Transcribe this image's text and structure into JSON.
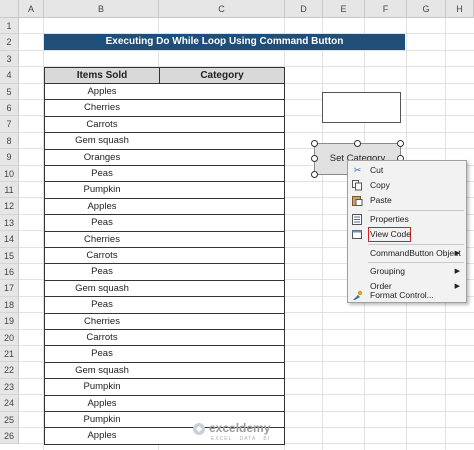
{
  "columns": [
    "A",
    "B",
    "C",
    "D",
    "E",
    "F",
    "G",
    "H"
  ],
  "rows": [
    "1",
    "2",
    "3",
    "4",
    "5",
    "6",
    "7",
    "8",
    "9",
    "10",
    "11",
    "12",
    "13",
    "14",
    "15",
    "16",
    "17",
    "18",
    "19",
    "20",
    "21",
    "22",
    "23",
    "24",
    "25",
    "26"
  ],
  "banner": {
    "title": "Executing Do While Loop Using Command Button"
  },
  "table": {
    "headers": [
      "Items Sold",
      "Category"
    ],
    "items": [
      "Apples",
      "Cherries",
      "Carrots",
      "Gem squash",
      "Oranges",
      "Peas",
      "Pumpkin",
      "Apples",
      "Peas",
      "Cherries",
      "Carrots",
      "Peas",
      "Gem squash",
      "Peas",
      "Cherries",
      "Carrots",
      "Peas",
      "Gem squash",
      "Pumpkin",
      "Apples",
      "Pumpkin",
      "Apples"
    ]
  },
  "command_button": {
    "label": "Set Category"
  },
  "context_menu": {
    "items": [
      {
        "label": "Cut",
        "icon": "scissors-icon"
      },
      {
        "label": "Copy",
        "icon": "copy-icon"
      },
      {
        "label": "Paste",
        "icon": "paste-icon"
      },
      {
        "label": "Properties",
        "icon": "properties-icon"
      },
      {
        "label": "View Code",
        "icon": "view-code-icon",
        "highlighted": true
      },
      {
        "label": "CommandButton Object",
        "submenu": true
      },
      {
        "label": "Grouping",
        "submenu": true
      },
      {
        "label": "Order",
        "submenu": true
      },
      {
        "label": "Format Control...",
        "icon": "format-control-icon"
      }
    ]
  },
  "watermark": {
    "brand": "exceldemy",
    "tagline": "EXCEL · DATA · BI"
  },
  "colors": {
    "banner": "#1f4e79",
    "header_fill": "#d9d9d9",
    "highlight": "#d62020"
  }
}
